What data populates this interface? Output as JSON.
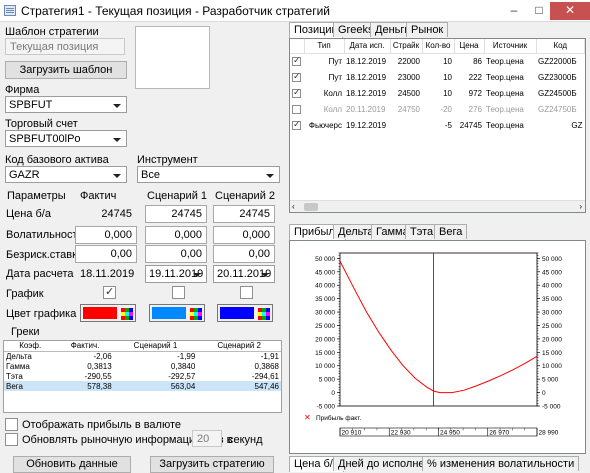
{
  "window": {
    "title": "Стратегия1 - Текущая позиция - Разработчик стратегий",
    "buttons": {
      "minimize": "–",
      "maximize": "□",
      "close": "✕"
    }
  },
  "left": {
    "template_label": "Шаблон стратегии",
    "template_value": "Текущая позиция",
    "load_template_button": "Загрузить шаблон",
    "firm_label": "Фирма",
    "firm_value": "SPBFUT",
    "account_label": "Торговый счет",
    "account_value": "SPBFUT00lPo",
    "base_asset_label": "Код базового актива",
    "base_asset_value": "GAZR",
    "instrument_label": "Инструмент",
    "instrument_value": "Все",
    "params": {
      "headers": [
        "Параметры",
        "Фактич",
        "Сценарий 1",
        "Сценарий 2"
      ],
      "price_label": "Цена б/а",
      "price": [
        "24745",
        "24745",
        "24745"
      ],
      "vol_label": "Волатильность",
      "vol": [
        "0,000",
        "0,000",
        "0,000"
      ],
      "rate_label": "Безриск.ставка",
      "rate": [
        "0,00",
        "0,00",
        "0,00"
      ],
      "date_label": "Дата расчета",
      "date": [
        "18.11.2019",
        "19.11.2019",
        "20.11.2019"
      ],
      "chart_label": "График",
      "chart_checks": [
        true,
        false,
        false
      ],
      "color_label": "Цвет графика",
      "colors": [
        "#ff0000",
        "#0088ff",
        "#0000ff"
      ]
    },
    "greeks": {
      "title": "Греки",
      "headers": [
        "Коэф.",
        "Фактич.",
        "Сценарий 1",
        "Сценарий 2"
      ],
      "rows": [
        {
          "name": "Дельта",
          "values": [
            "-2,06",
            "-1,99",
            "-1,91"
          ]
        },
        {
          "name": "Гамма",
          "values": [
            "0,3813",
            "0,3840",
            "0,3868"
          ]
        },
        {
          "name": "Тэта",
          "values": [
            "-290,55",
            "-292,57",
            "-294,61"
          ]
        },
        {
          "name": "Вега",
          "values": [
            "578,38",
            "563,04",
            "547,46"
          ]
        }
      ]
    },
    "show_profit_label": "Отображать прибыль в валюте",
    "refresh_label": "Обновлять рыночную информацию раз в",
    "refresh_value": "20",
    "refresh_unit": "секунд",
    "update_button": "Обновить данные",
    "load_strategy_button": "Загрузить стратегию"
  },
  "right": {
    "top_tabs": [
      "Позиции",
      "Greeks",
      "Деньги",
      "Рынок"
    ],
    "positions": {
      "headers": [
        "Тип",
        "Дата исп.",
        "Страйк",
        "Кол-во",
        "Цена",
        "Источник",
        "Код"
      ],
      "rows": [
        {
          "checked": true,
          "dim": false,
          "type": "Пут",
          "date": "18.12.2019",
          "strike": "22000",
          "qty": "10",
          "price": "86",
          "source": "Теор.цена",
          "code": "GZ22000Б"
        },
        {
          "checked": true,
          "dim": false,
          "type": "Пут",
          "date": "18.12.2019",
          "strike": "23000",
          "qty": "10",
          "price": "222",
          "source": "Теор.цена",
          "code": "GZ23000Б"
        },
        {
          "checked": true,
          "dim": false,
          "type": "Колл",
          "date": "18.12.2019",
          "strike": "24500",
          "qty": "10",
          "price": "972",
          "source": "Теор.цена",
          "code": "GZ24500Б"
        },
        {
          "checked": false,
          "dim": true,
          "type": "Колл",
          "date": "20.11.2019",
          "strike": "24750",
          "qty": "-20",
          "price": "276",
          "source": "Теор.цена",
          "code": "GZ24750Б"
        },
        {
          "checked": true,
          "dim": false,
          "type": "Фьючерс",
          "date": "19.12.2019",
          "strike": "",
          "qty": "-5",
          "price": "24745",
          "source": "Теор.цена",
          "code": "GZ"
        }
      ]
    },
    "chart_tabs": [
      "Прибыль",
      "Дельта",
      "Гамма",
      "Тэта",
      "Вега"
    ],
    "bottom_tabs": [
      "Цена б/а",
      "Дней до исполнения",
      "% изменения волатильности"
    ],
    "legend_label": "Прибыль факт.",
    "colors": {
      "profit_line": "#ff0000",
      "current_price_line": "#cc0000"
    }
  },
  "chart_data": {
    "type": "line",
    "title": "",
    "xlabel": "",
    "ylabel": "",
    "x_ticks": [
      "20 910",
      "22 930",
      "24 950",
      "26 970",
      "28 990"
    ],
    "y_ticks": [
      "-5 000",
      "0",
      "5 000",
      "10 000",
      "15 000",
      "20 000",
      "25 000",
      "30 000",
      "35 000",
      "40 000",
      "45 000",
      "50 000"
    ],
    "xlim": [
      20910,
      28990
    ],
    "ylim": [
      -5000,
      52000
    ],
    "current_price": 24745,
    "grid": false,
    "legend": "bottom-left",
    "series": [
      {
        "name": "Прибыль факт.",
        "x": [
          20910,
          21500,
          22000,
          22500,
          23000,
          23500,
          24000,
          24500,
          24745,
          25000,
          25500,
          26000,
          26500,
          27000,
          27500,
          28000,
          28500,
          28990
        ],
        "y": [
          49000,
          38500,
          30000,
          22500,
          15800,
          10000,
          5300,
          1800,
          600,
          0,
          0,
          900,
          2500,
          4300,
          6300,
          8500,
          10900,
          13500
        ]
      }
    ]
  }
}
